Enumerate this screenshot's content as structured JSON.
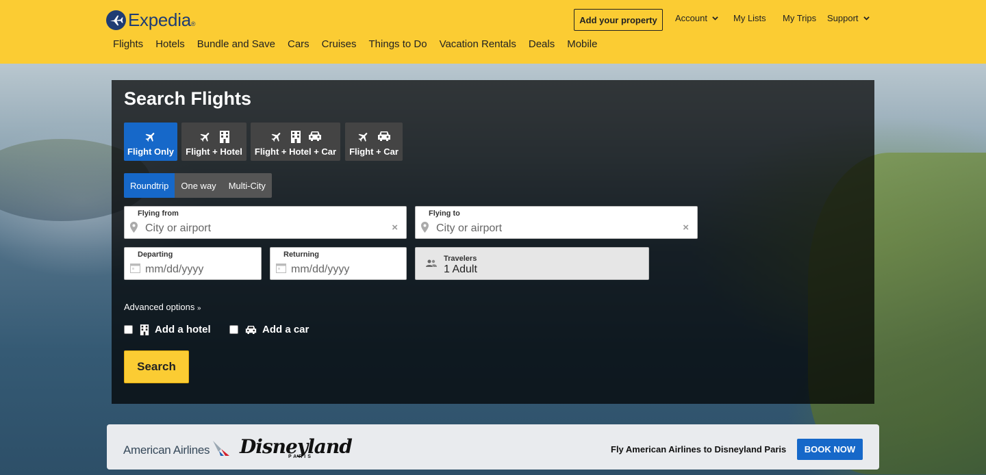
{
  "brand": {
    "name": "Expedia",
    "tm": "®"
  },
  "header": {
    "add_property": "Add your property",
    "account": "Account",
    "my_lists": "My Lists",
    "my_trips": "My Trips",
    "support": "Support"
  },
  "nav": [
    "Flights",
    "Hotels",
    "Bundle and Save",
    "Cars",
    "Cruises",
    "Things to Do",
    "Vacation Rentals",
    "Deals",
    "Mobile"
  ],
  "search": {
    "title": "Search Flights",
    "tabs": [
      {
        "label": "Flight Only",
        "icons": [
          "plane-icon"
        ],
        "active": true
      },
      {
        "label": "Flight + Hotel",
        "icons": [
          "plane-icon",
          "building-icon"
        ],
        "active": false
      },
      {
        "label": "Flight + Hotel + Car",
        "icons": [
          "plane-icon",
          "building-icon",
          "car-icon"
        ],
        "active": false
      },
      {
        "label": "Flight + Car",
        "icons": [
          "plane-icon",
          "car-icon"
        ],
        "active": false
      }
    ],
    "trip_types": [
      "Roundtrip",
      "One way",
      "Multi-City"
    ],
    "trip_type_selected": "Roundtrip",
    "flying_from": {
      "label": "Flying from",
      "placeholder": "City or airport",
      "value": ""
    },
    "flying_to": {
      "label": "Flying to",
      "placeholder": "City or airport",
      "value": ""
    },
    "departing": {
      "label": "Departing",
      "placeholder": "mm/dd/yyyy"
    },
    "returning": {
      "label": "Returning",
      "placeholder": "mm/dd/yyyy"
    },
    "travelers": {
      "label": "Travelers",
      "value": "1 Adult"
    },
    "advanced_options": "Advanced options",
    "add_hotel": "Add a hotel",
    "add_car": "Add a car",
    "search_button": "Search"
  },
  "promo": {
    "airline": "American Airlines",
    "disney": "Disneyland",
    "disney_sub": "PARIS",
    "text": "Fly American Airlines to Disneyland Paris",
    "cta": "BOOK NOW"
  },
  "colors": {
    "header": "#fbcc33",
    "accent": "#1668c9",
    "brand": "#1f3c73"
  }
}
